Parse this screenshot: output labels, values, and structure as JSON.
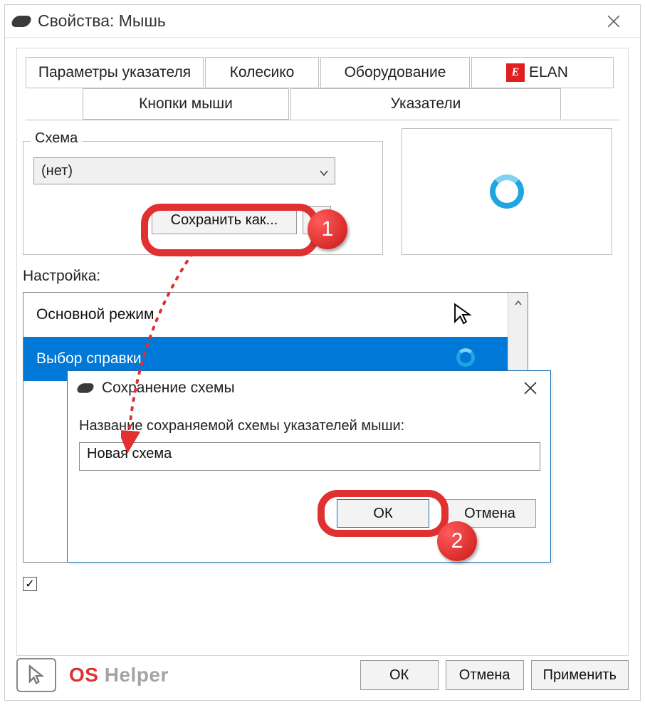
{
  "window": {
    "title": "Свойства: Мышь"
  },
  "tabs": {
    "row1": [
      {
        "label": "Параметры указателя"
      },
      {
        "label": "Колесико"
      },
      {
        "label": "Оборудование"
      },
      {
        "label": "ELAN"
      }
    ],
    "row2": [
      {
        "label": "Кнопки мыши"
      },
      {
        "label": "Указатели",
        "selected": true
      }
    ]
  },
  "scheme": {
    "legend": "Схема",
    "dropdown_value": "(нет)",
    "save_as": "Сохранить как..."
  },
  "customize_label": "Настройка:",
  "list": {
    "items": [
      {
        "label": "Основной режим",
        "cursor": "arrow"
      },
      {
        "label": "Выбор справки",
        "cursor": "ring",
        "selected": true
      }
    ]
  },
  "sub_dialog": {
    "title": "Сохранение схемы",
    "field_label": "Название сохраняемой схемы указателей мыши:",
    "input_value": "Новая схема",
    "ok": "ОК",
    "cancel": "Отмена"
  },
  "callouts": [
    {
      "n": "1"
    },
    {
      "n": "2"
    }
  ],
  "bottom": {
    "ok": "ОК",
    "cancel": "Отмена",
    "apply": "Применить"
  },
  "logo": {
    "a": "OS",
    "b": " Helper"
  }
}
